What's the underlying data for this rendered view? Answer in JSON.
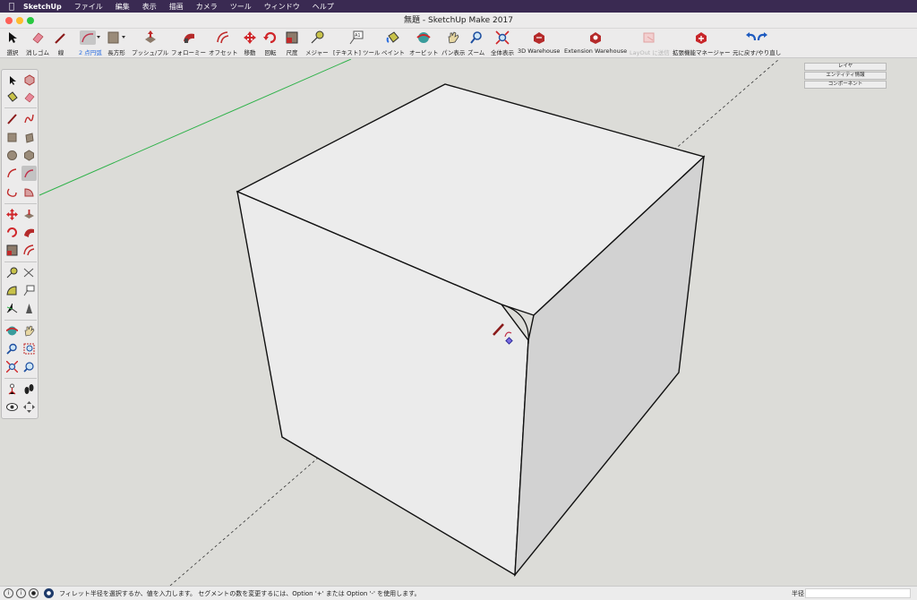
{
  "menubar": {
    "apple_icon": "apple-icon",
    "app_name": "SketchUp",
    "items": [
      "ファイル",
      "編集",
      "表示",
      "描画",
      "カメラ",
      "ツール",
      "ウィンドウ",
      "ヘルプ"
    ]
  },
  "window": {
    "title": "無題 - SketchUp Make 2017"
  },
  "toolbar": {
    "select": "選択",
    "eraser": "消しゴム",
    "line": "線",
    "arc": "2 点円弧",
    "rectangle": "長方形",
    "pushpull": "プッシュ/プル",
    "followme": "フォローミー",
    "offset": "オフセット",
    "move": "移動",
    "rotate": "回転",
    "scale": "尺度",
    "tape": "メジャー",
    "text": "[テキスト] ツール",
    "paint": "ペイント",
    "orbit": "オービット",
    "pan": "パン表示",
    "zoom": "ズーム",
    "zoom_extents": "全体表示",
    "warehouse": "3D Warehouse",
    "extension_warehouse": "Extension Warehouse",
    "layout": "LayOut に送信",
    "extension_manager": "拡張機能マネージャー",
    "undo_redo": "元に戻す/やり直し",
    "active_tool": "arc",
    "accent_color": "#2a6de0"
  },
  "tray": {
    "layers": "レイヤ",
    "entity_info": "エンティティ情報",
    "components": "コンポーネント"
  },
  "status": {
    "message": "フィレット半径を選択するか、値を入力します。 セグメントの数を変更するには、Option '+' または Option '-' を使用します。",
    "vcb_label": "半径",
    "vcb_value": ""
  },
  "colors": {
    "viewport_bg": "#dcdcd8",
    "green_axis": "#2fb24a",
    "edge": "#111111"
  }
}
